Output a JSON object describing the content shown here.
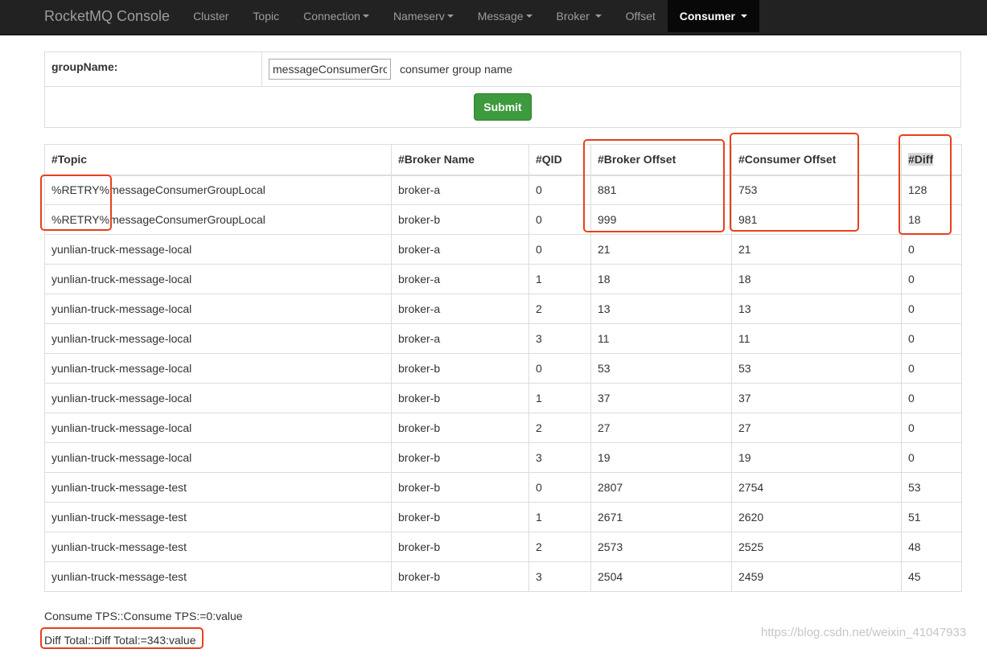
{
  "navbar": {
    "brand": "RocketMQ Console",
    "items": [
      {
        "label": "Cluster"
      },
      {
        "label": "Topic"
      },
      {
        "label": "Connection"
      },
      {
        "label": "Nameserv"
      },
      {
        "label": "Message"
      },
      {
        "label": "Broker "
      },
      {
        "label": "Offset"
      },
      {
        "label": "Consumer "
      }
    ]
  },
  "query": {
    "group_label": "groupName:",
    "group_value": "messageConsumerGroupLocal",
    "group_hint": "consumer group name",
    "submit_label": "Submit"
  },
  "table": {
    "headers": [
      "#Topic",
      "#Broker Name",
      "#QID",
      "#Broker Offset",
      "#Consumer Offset",
      "#Diff"
    ],
    "rows": [
      [
        "%RETRY%messageConsumerGroupLocal",
        "broker-a",
        "0",
        "881",
        "753",
        "128"
      ],
      [
        "%RETRY%messageConsumerGroupLocal",
        "broker-b",
        "0",
        "999",
        "981",
        "18"
      ],
      [
        "yunlian-truck-message-local",
        "broker-a",
        "0",
        "21",
        "21",
        "0"
      ],
      [
        "yunlian-truck-message-local",
        "broker-a",
        "1",
        "18",
        "18",
        "0"
      ],
      [
        "yunlian-truck-message-local",
        "broker-a",
        "2",
        "13",
        "13",
        "0"
      ],
      [
        "yunlian-truck-message-local",
        "broker-a",
        "3",
        "11",
        "11",
        "0"
      ],
      [
        "yunlian-truck-message-local",
        "broker-b",
        "0",
        "53",
        "53",
        "0"
      ],
      [
        "yunlian-truck-message-local",
        "broker-b",
        "1",
        "37",
        "37",
        "0"
      ],
      [
        "yunlian-truck-message-local",
        "broker-b",
        "2",
        "27",
        "27",
        "0"
      ],
      [
        "yunlian-truck-message-local",
        "broker-b",
        "3",
        "19",
        "19",
        "0"
      ],
      [
        "yunlian-truck-message-test",
        "broker-b",
        "0",
        "2807",
        "2754",
        "53"
      ],
      [
        "yunlian-truck-message-test",
        "broker-b",
        "1",
        "2671",
        "2620",
        "51"
      ],
      [
        "yunlian-truck-message-test",
        "broker-b",
        "2",
        "2573",
        "2525",
        "48"
      ],
      [
        "yunlian-truck-message-test",
        "broker-b",
        "3",
        "2504",
        "2459",
        "45"
      ]
    ]
  },
  "summary": {
    "tps": "Consume TPS::Consume TPS:=0:value",
    "diff_total": "Diff Total::Diff Total:=343:value"
  },
  "watermark": "https://blog.csdn.net/weixin_41047933",
  "colors": {
    "navbar_bg": "#222222",
    "highlight": "#e8401c",
    "submit_bg": "#3d9a3d"
  }
}
